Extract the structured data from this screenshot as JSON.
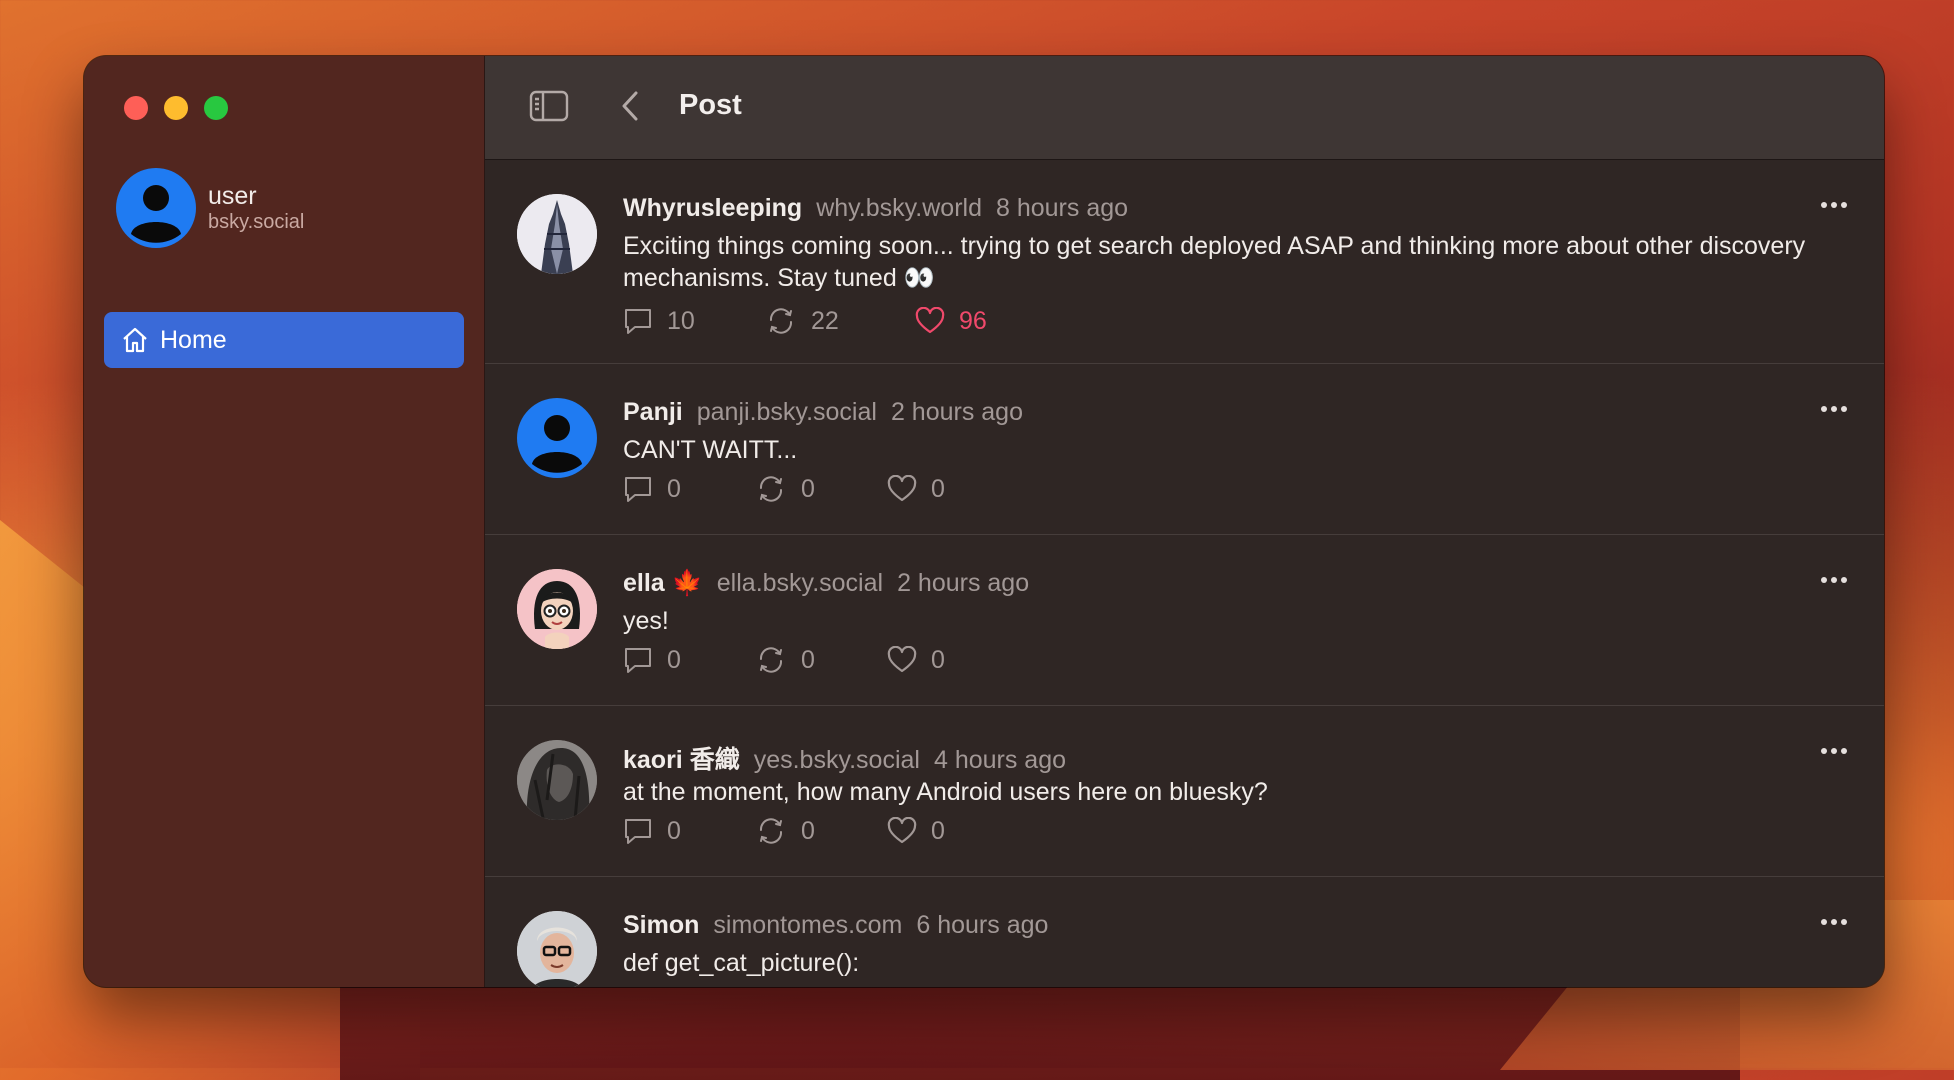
{
  "sidebar": {
    "account": {
      "name": "user",
      "handle": "bsky.social"
    },
    "nav": {
      "home_label": "Home"
    }
  },
  "toolbar": {
    "title": "Post"
  },
  "posts": [
    {
      "name": "Whyrusleeping",
      "handle": "why.bsky.world",
      "time": "8 hours ago",
      "text": "Exciting things coming soon... trying to get search deployed ASAP and thinking more about other discovery mechanisms. Stay tuned 👀",
      "replies": "10",
      "reposts": "22",
      "likes": "96",
      "liked": true
    },
    {
      "name": "Panji",
      "handle": "panji.bsky.social",
      "time": "2 hours ago",
      "text": "CAN'T WAITT...",
      "replies": "0",
      "reposts": "0",
      "likes": "0",
      "liked": false
    },
    {
      "name": "ella 🍁",
      "handle": "ella.bsky.social",
      "time": "2 hours ago",
      "text": "yes!",
      "replies": "0",
      "reposts": "0",
      "likes": "0",
      "liked": false
    },
    {
      "name": "kaori 香織",
      "handle": "yes.bsky.social",
      "time": "4 hours ago",
      "text": "at the moment, how many Android users here on bluesky?",
      "replies": "0",
      "reposts": "0",
      "likes": "0",
      "liked": false
    },
    {
      "name": "Simon",
      "handle": "simontomes.com",
      "time": "6 hours ago",
      "text": "def get_cat_picture():",
      "replies": "",
      "reposts": "",
      "likes": "",
      "liked": false
    }
  ],
  "colors": {
    "accent": "#3a6ad8",
    "like": "#f0496b",
    "sidebar": "#52261f",
    "content": "#2f2624"
  }
}
